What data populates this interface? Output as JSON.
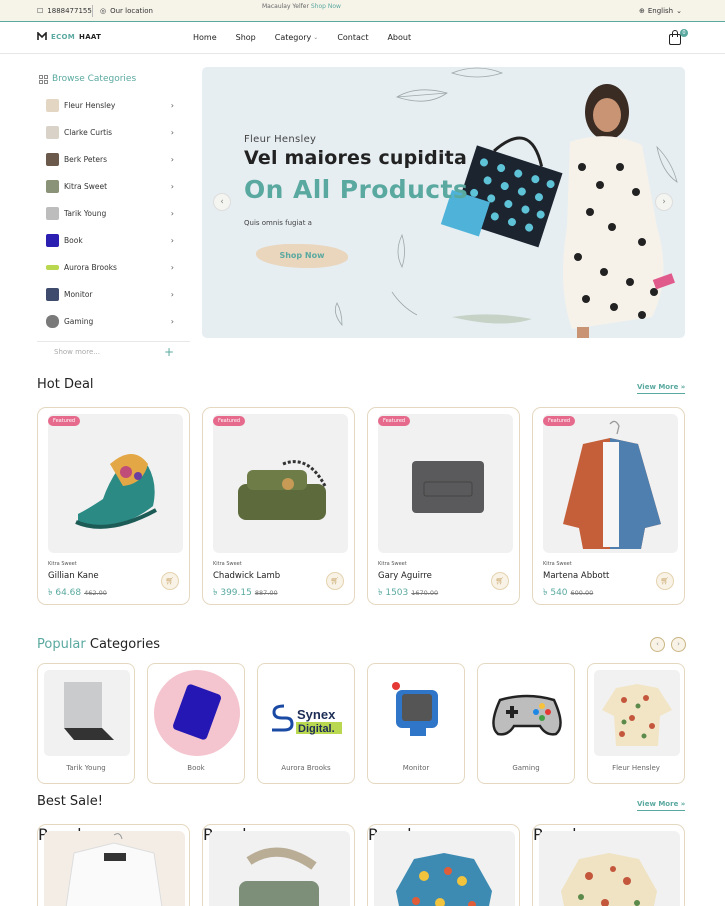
{
  "topbar": {
    "phone": "1888477155",
    "location": "Our location",
    "promo_text": "Macaulay Yelfer",
    "promo_link": "Shop Now",
    "language": "English"
  },
  "header": {
    "logo_part1": "ECOM",
    "logo_part2": "HAAT",
    "nav": [
      "Home",
      "Shop",
      "Category",
      "Contact",
      "About"
    ],
    "cart_count": "0"
  },
  "sidebar": {
    "title": "Browse Categories",
    "items": [
      "Fleur Hensley",
      "Clarke Curtis",
      "Berk Peters",
      "Kitra Sweet",
      "Tarik Young",
      "Book",
      "Aurora Brooks",
      "Monitor",
      "Gaming"
    ],
    "show_more": "Show more..."
  },
  "hero": {
    "subtitle": "Fleur Hensley",
    "title_line1": "Vel maiores cupidita",
    "title_line2": "On All Products",
    "description": "Quis omnis fugiat a",
    "cta": "Shop Now"
  },
  "hot_deal": {
    "title": "Hot Deal",
    "view_more": "View More",
    "products": [
      {
        "tag": "Featured",
        "brand": "Kitra Sweet",
        "name": "Gillian Kane",
        "price": "৳ 64.68",
        "old_price": "462.00"
      },
      {
        "tag": "Featured",
        "brand": "Kitra Sweet",
        "name": "Chadwick Lamb",
        "price": "৳ 399.15",
        "old_price": "887.00"
      },
      {
        "tag": "Featured",
        "brand": "Kitra Sweet",
        "name": "Gary Aguirre",
        "price": "৳ 1503",
        "old_price": "1670.00"
      },
      {
        "tag": "Featured",
        "brand": "Kitra Sweet",
        "name": "Martena Abbott",
        "price": "৳ 540",
        "old_price": "600.00"
      }
    ]
  },
  "popular_categories": {
    "title_accent": "Popular",
    "title_rest": "Categories",
    "items": [
      "Tarik Young",
      "Book",
      "Aurora Brooks",
      "Monitor",
      "Gaming",
      "Fleur Hensley"
    ],
    "synex_line1": "Synex",
    "synex_line2": "Digital."
  },
  "best_sale": {
    "title": "Best Sale!",
    "view_more": "View More",
    "tags": [
      "Popular",
      "Popular",
      "Popular",
      "Popular"
    ]
  },
  "colors": {
    "accent": "#5aa9a0",
    "featured_tag": "#e66a8c",
    "popular_tag": "#8aa99d",
    "card_border": "#e5d8c1"
  }
}
